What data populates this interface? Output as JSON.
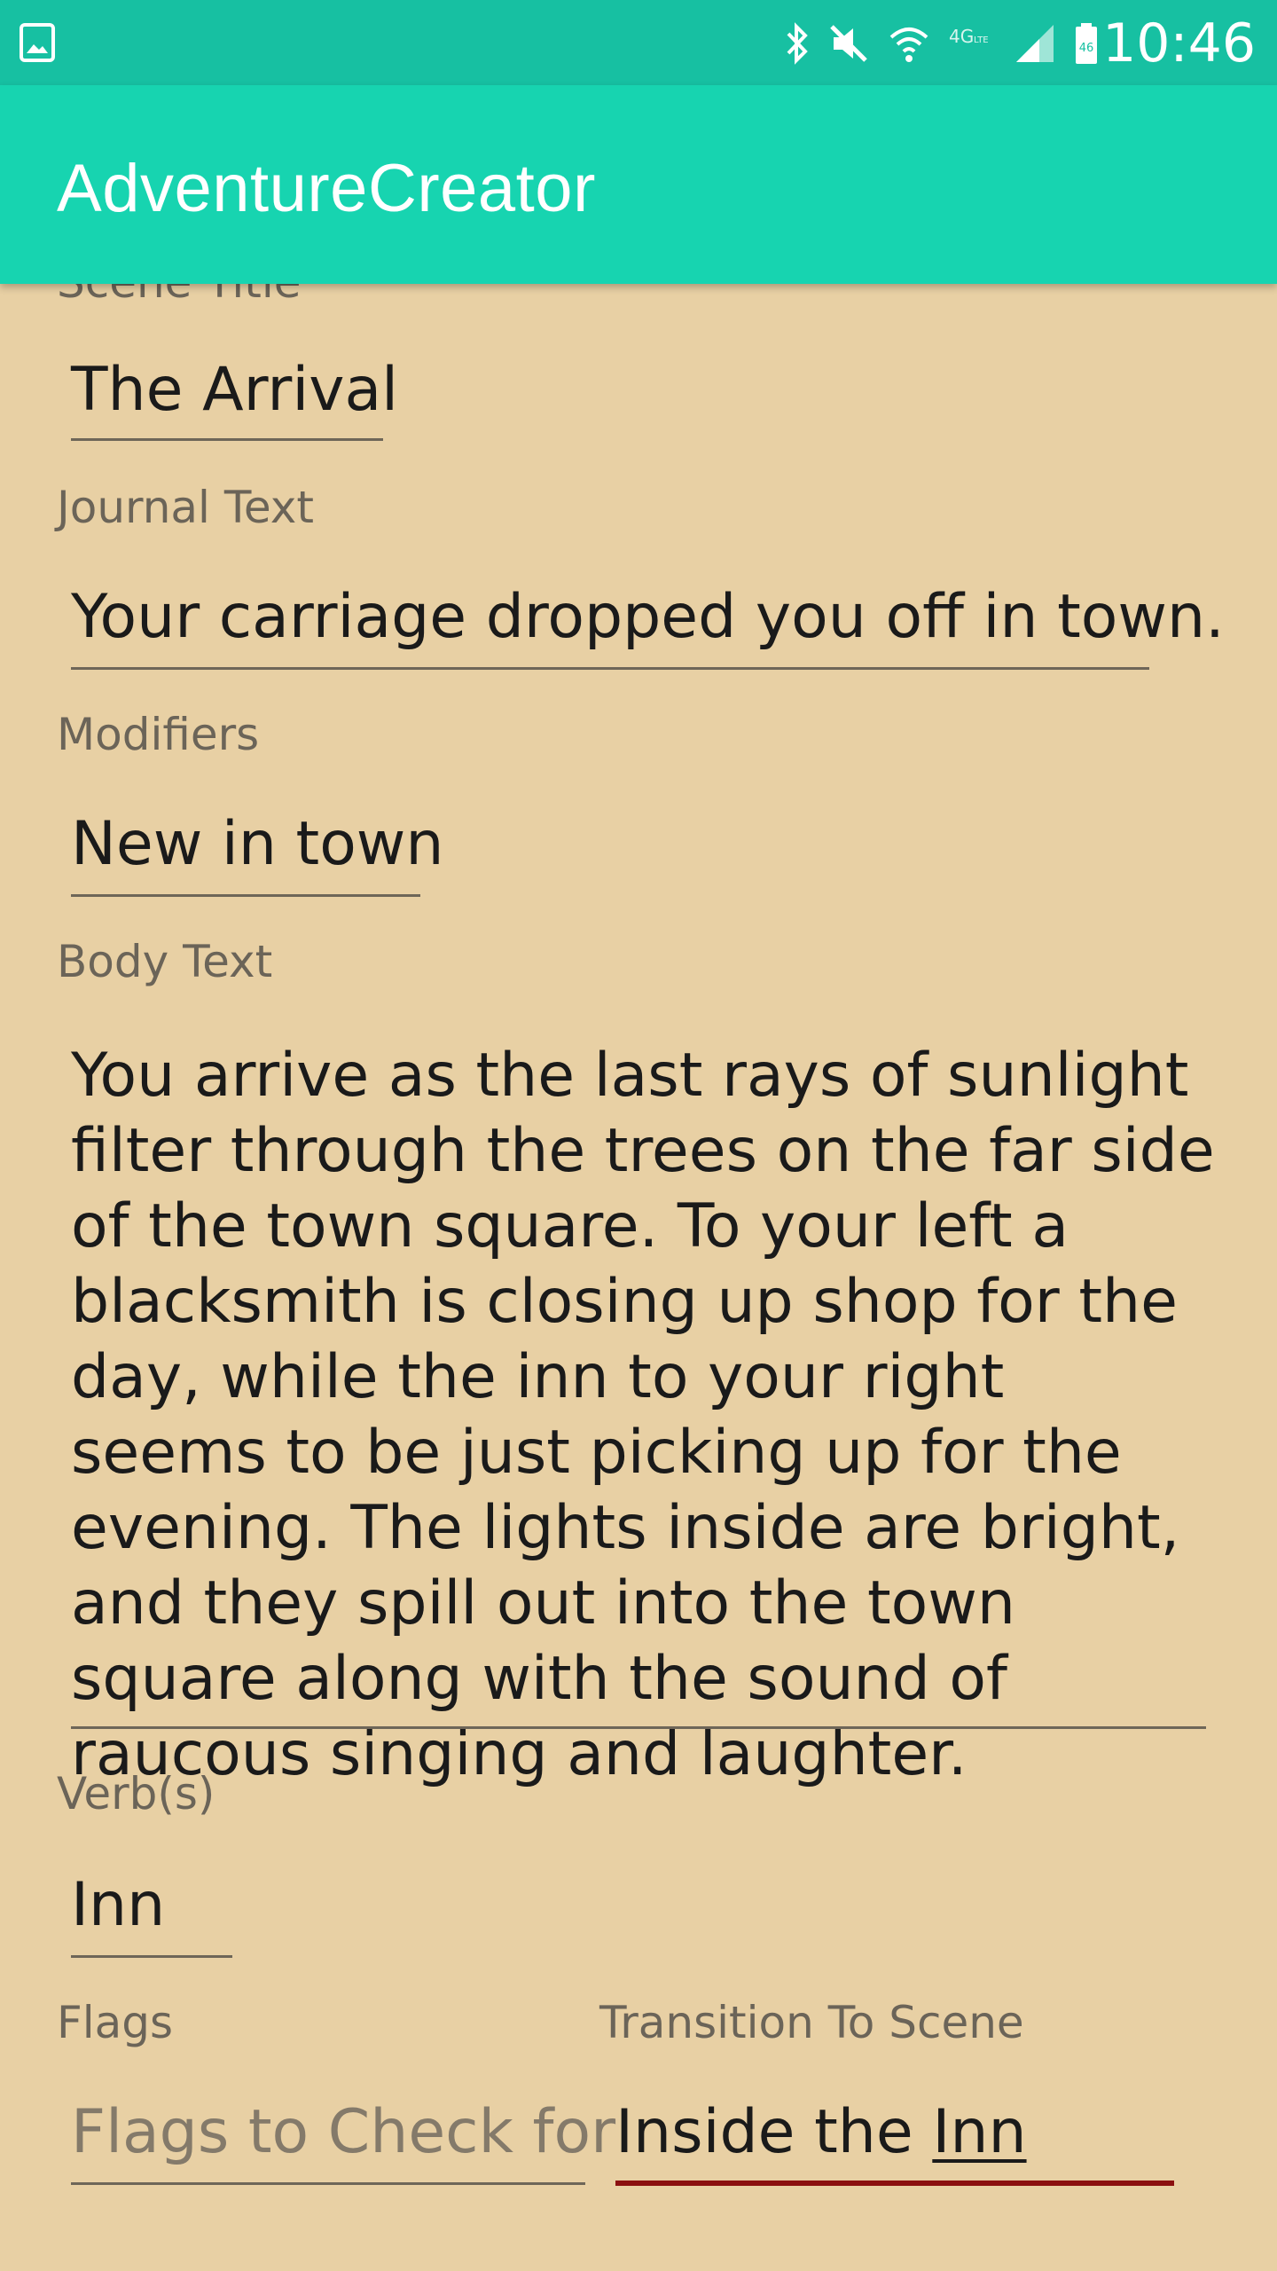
{
  "status_bar": {
    "time": "10:46",
    "icons": [
      "gallery-icon",
      "bluetooth-icon",
      "mute-icon",
      "wifi-icon",
      "4g-lte-icon",
      "signal-icon",
      "battery-icon"
    ],
    "colors": {
      "background": "#17c0a2"
    }
  },
  "app_bar": {
    "title": "AdventureCreator",
    "color": "#17d4b0"
  },
  "form": {
    "scene_title": {
      "label": "Scene Title",
      "value": "The Arrival"
    },
    "journal_text": {
      "label": "Journal Text",
      "value": "Your carriage dropped you off in town."
    },
    "modifiers": {
      "label": "Modifiers",
      "value": "New in town"
    },
    "body_text": {
      "label": "Body Text",
      "value": "You arrive as the last rays of sunlight filter through the trees on the far side of the town square. To your left a blacksmith is closing up shop for the day, while the inn to your right seems to be just picking up for the evening. The lights inside are bright, and they spill out into the town square along with the sound of raucous singing and laughter."
    },
    "verbs": {
      "label": "Verb(s)",
      "value": "Inn"
    },
    "flags": {
      "label": "Flags",
      "placeholder": "Flags to Check for"
    },
    "transition": {
      "label": "Transition To Scene",
      "value_prefix": "Inside the ",
      "value_link": "Inn",
      "accent": "#8b1010"
    }
  },
  "colors": {
    "background": "#e8d0a4",
    "label": "#6b6458",
    "text": "#1a1a1a"
  }
}
